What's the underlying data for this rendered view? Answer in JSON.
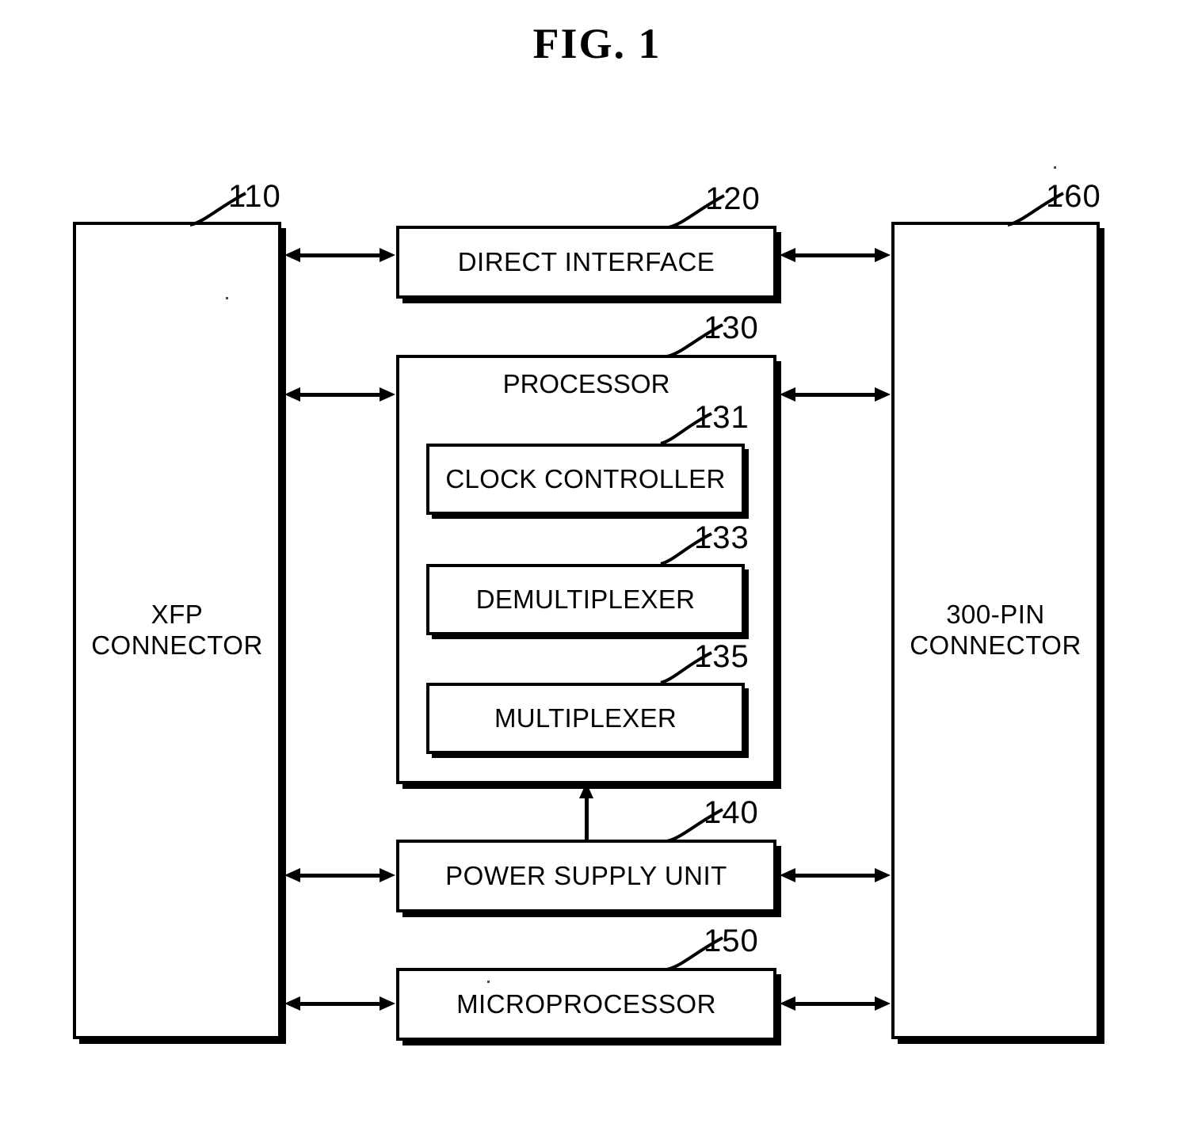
{
  "figure": {
    "title": "FIG.  1"
  },
  "blocks": {
    "xfp_connector": {
      "ref": "110",
      "label": "XFP\nCONNECTOR"
    },
    "direct_interface": {
      "ref": "120",
      "label": "DIRECT INTERFACE"
    },
    "processor": {
      "ref": "130",
      "label": "PROCESSOR"
    },
    "clock_controller": {
      "ref": "131",
      "label": "CLOCK CONTROLLER"
    },
    "demultiplexer": {
      "ref": "133",
      "label": "DEMULTIPLEXER"
    },
    "multiplexer": {
      "ref": "135",
      "label": "MULTIPLEXER"
    },
    "power_supply_unit": {
      "ref": "140",
      "label": "POWER SUPPLY UNIT"
    },
    "microprocessor": {
      "ref": "150",
      "label": "MICROPROCESSOR"
    },
    "pin_connector": {
      "ref": "160",
      "label": "300-PIN\nCONNECTOR"
    }
  },
  "colors": {
    "ink": "#000000",
    "paper": "#ffffff"
  }
}
